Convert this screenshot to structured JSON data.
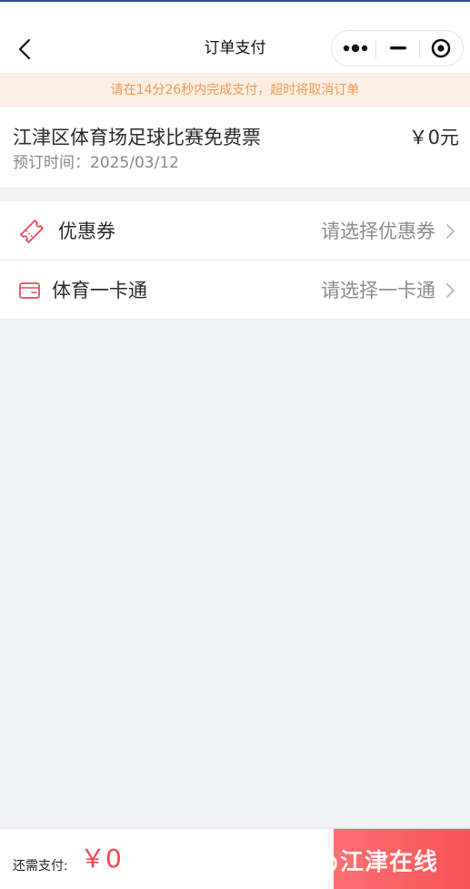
{
  "header": {
    "title": "订单支付",
    "back_icon": "chevron-left-icon",
    "menu_icon": "more-dots-icon",
    "minimize_icon": "minus-icon",
    "close_icon": "target-circle-icon"
  },
  "notice": {
    "text": "请在14分26秒内完成支付，超时将取消订单",
    "color": "#ee9a55",
    "background": "#fdeee3"
  },
  "order": {
    "name": "江津区体育场足球比赛免费票",
    "price": "￥0元",
    "time": "预订时间：2025/03/12"
  },
  "options": [
    {
      "icon": "coupon-ticket-icon",
      "label": "优惠券",
      "value": "请选择优惠券"
    },
    {
      "icon": "card-wallet-icon",
      "label": "体育一卡通",
      "value": "请选择一卡通"
    }
  ],
  "footer": {
    "due_label": "还需支付:",
    "due_amount": "￥0",
    "watermark": "江津在线",
    "accent": "#f0474f"
  }
}
